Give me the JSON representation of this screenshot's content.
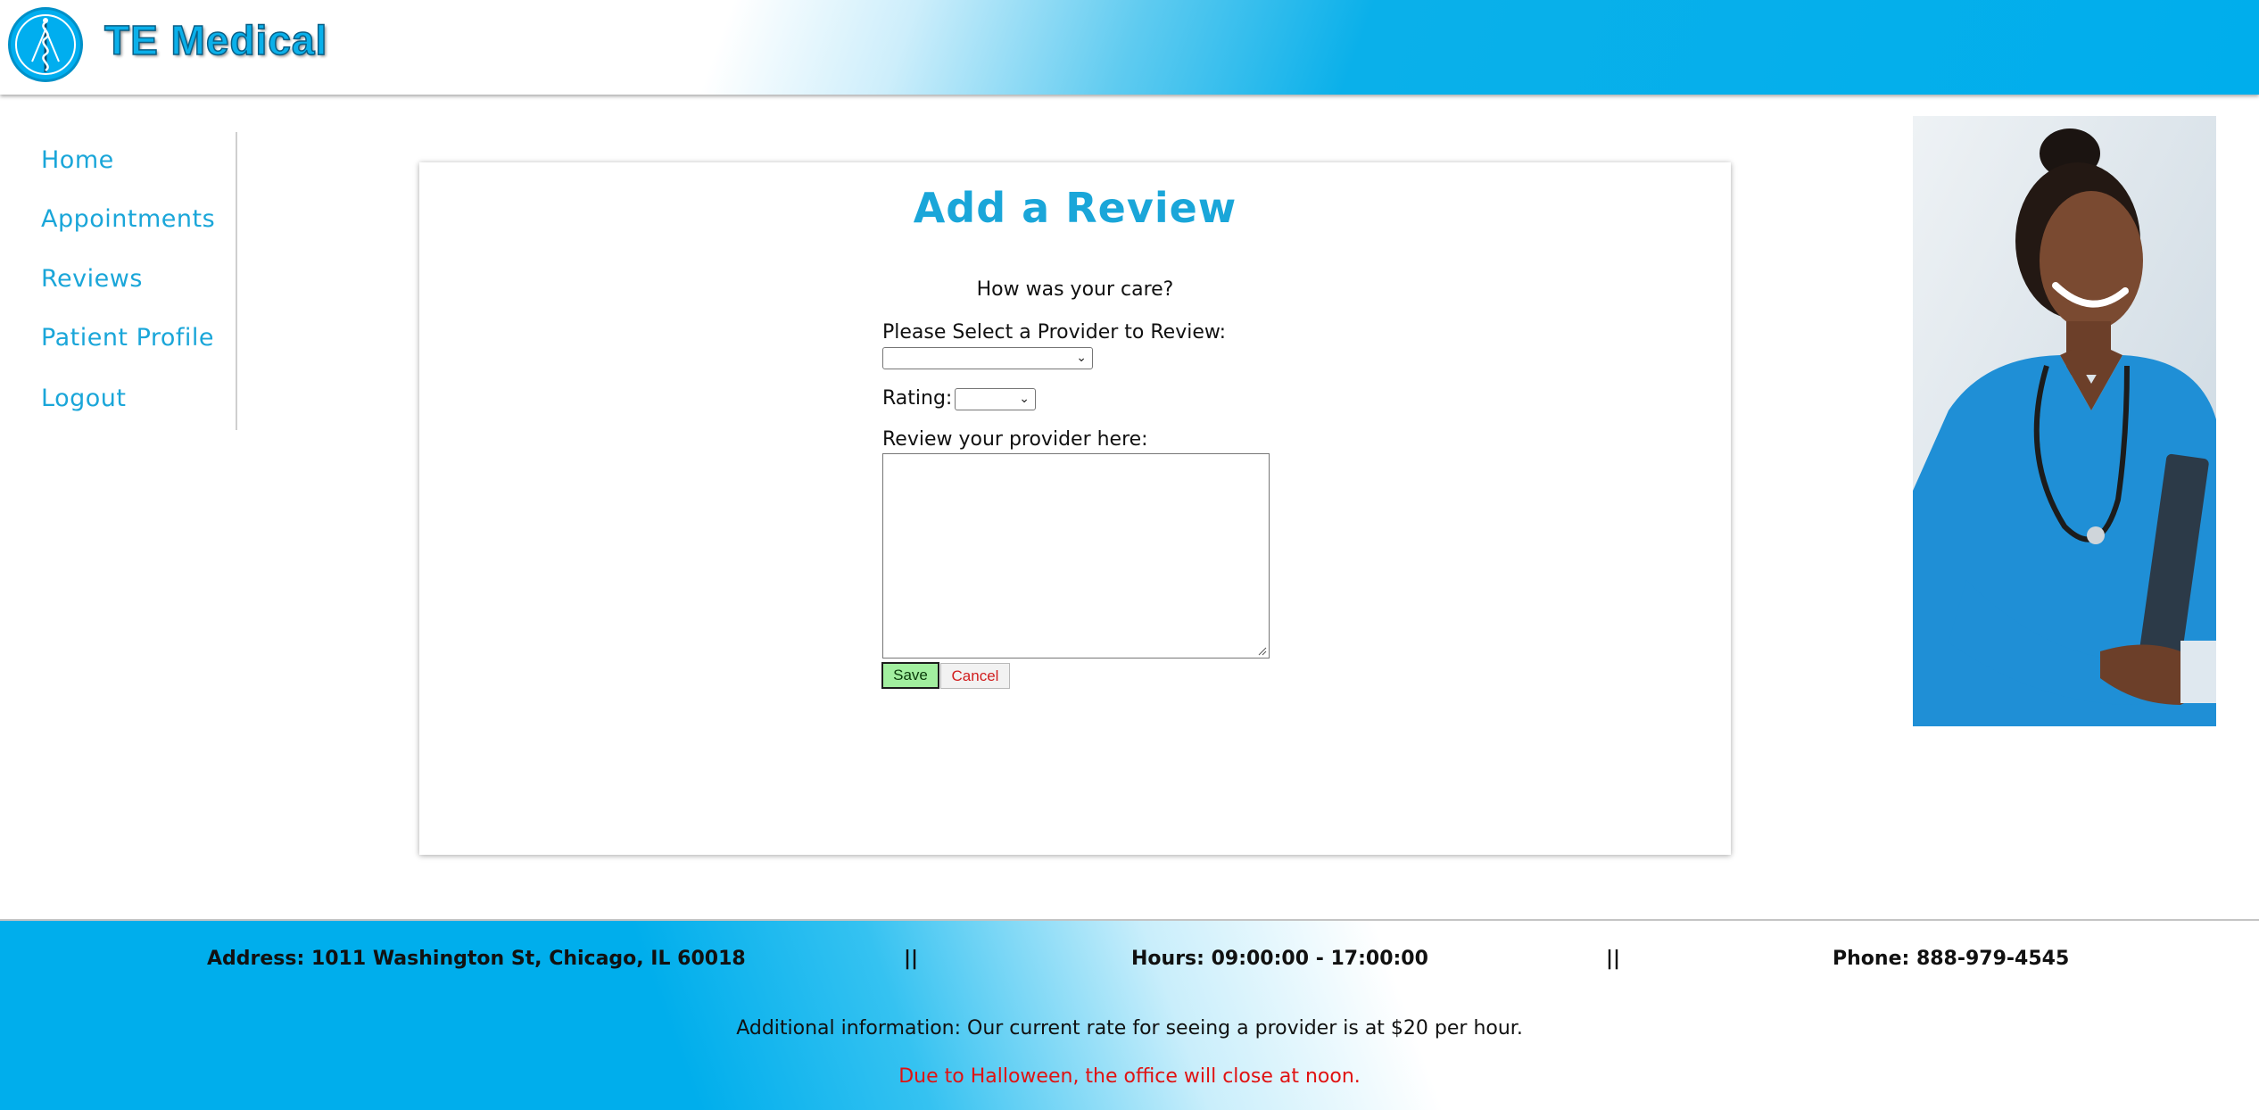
{
  "header": {
    "brand": "TE Medical"
  },
  "nav": {
    "items": [
      {
        "label": "Home"
      },
      {
        "label": "Appointments"
      },
      {
        "label": "Reviews"
      },
      {
        "label": "Patient Profile"
      },
      {
        "label": "Logout"
      }
    ]
  },
  "form": {
    "title": "Add a Review",
    "subtitle": "How was your care?",
    "provider_label": "Please Select a Provider to Review:",
    "provider_value": "",
    "rating_label": "Rating:",
    "rating_value": "",
    "review_label": "Review your provider here:",
    "review_value": "",
    "save_label": "Save",
    "cancel_label": "Cancel"
  },
  "footer": {
    "address": "Address: 1011 Washington St, Chicago, IL 60018",
    "separator": "||",
    "hours": "Hours: 09:00:00 - 17:00:00",
    "phone": "Phone: 888-979-4545",
    "info": "Additional information: Our current rate for seeing a provider is at $20 per hour.",
    "notice": "Due to Halloween, the office will close at noon."
  },
  "colors": {
    "brand_blue": "#00aeec",
    "nav_link": "#1aa6d9",
    "save_bg": "#a2ef9f",
    "cancel_text": "#d11d1d",
    "notice_red": "#e01212"
  },
  "icons": [
    "caduceus-logo-icon",
    "chevron-down-icon",
    "resize-grip-icon"
  ]
}
